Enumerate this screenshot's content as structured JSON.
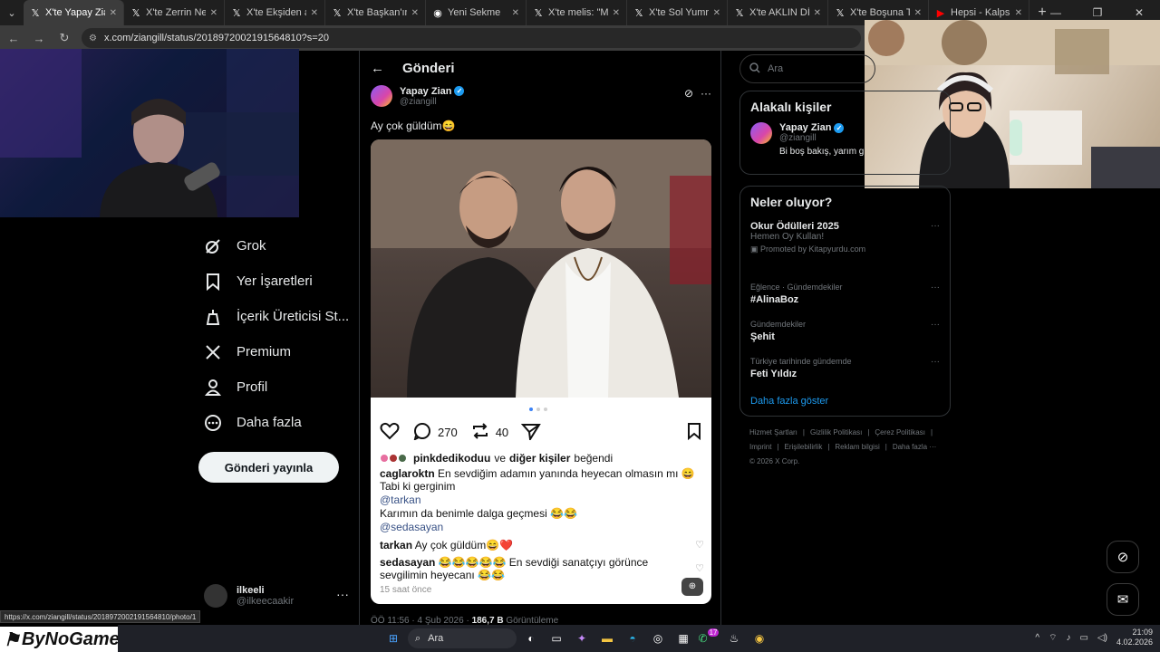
{
  "browser": {
    "tabs": [
      {
        "icon": "x-icon",
        "title": "X'te Yapay Zian: \"A",
        "active": true
      },
      {
        "icon": "x-icon",
        "title": "X'te Zerrin Nergiz",
        "active": false
      },
      {
        "icon": "x-icon",
        "title": "X'te Ekşiden alıntı",
        "active": false
      },
      {
        "icon": "x-icon",
        "title": "X'te Başkan'ın Ru",
        "active": false
      },
      {
        "icon": "chrome-icon",
        "title": "Yeni Sekme",
        "active": false
      },
      {
        "icon": "x-icon",
        "title": "X'te melis: \"Mate",
        "active": false
      },
      {
        "icon": "x-icon",
        "title": "X'te Sol Yumruk: \"",
        "active": false
      },
      {
        "icon": "x-icon",
        "title": "X'te AKLIN DİNİ: o",
        "active": false
      },
      {
        "icon": "x-icon",
        "title": "X'te Boşuna Tıklad",
        "active": false
      },
      {
        "icon": "youtube-icon",
        "title": "Hepsi - Kalpsizsin",
        "active": false
      }
    ],
    "url": "x.com/ziangill/status/2018972002191564810?s=20",
    "status_url": "https://x.com/ziangill/status/2018972002191564810/photo/1"
  },
  "sidebar": {
    "items": [
      {
        "label": "Grok",
        "icon": "grok-icon"
      },
      {
        "label": "Yer İşaretleri",
        "icon": "bookmark-icon"
      },
      {
        "label": "İçerik Üreticisi St...",
        "icon": "creator-studio-icon"
      },
      {
        "label": "Premium",
        "icon": "x-logo-icon"
      },
      {
        "label": "Profil",
        "icon": "person-icon"
      },
      {
        "label": "Daha fazla",
        "icon": "more-circle-icon"
      }
    ],
    "post_button": "Gönderi yayınla",
    "account": {
      "name": "ilkeeli",
      "handle": "@ilkeecaakir"
    }
  },
  "post": {
    "header": "Gönderi",
    "author_name": "Yapay Zian",
    "author_handle": "@ziangill",
    "text": "Ay çok güldüm😄",
    "meta_time": "ÖÖ 11:56 · 4 Şub 2026 · ",
    "meta_views": "186,7 B",
    "meta_views_label": " Görüntüleme"
  },
  "instagram": {
    "comment_count": "270",
    "repost_count": "40",
    "liked_user": "pinkdedikoduu",
    "liked_joiner": " ve ",
    "liked_others": "diğer kişiler",
    "liked_suffix": " beğendi",
    "comments": [
      {
        "user": "caglaroktn",
        "text": " En sevdiğim adamın yanında heyecan olmasın mı 😄"
      },
      {
        "user": "",
        "text": "Tabi ki gerginim"
      },
      {
        "user": "",
        "text": "@tarkan"
      },
      {
        "user": "",
        "text": "Karımın da benimle  dalga geçmesi 😂😂"
      },
      {
        "user": "",
        "text": "@sedasayan"
      },
      {
        "user": "tarkan",
        "text": " Ay çok güldüm😄❤️"
      },
      {
        "user": "sedasayan",
        "text": " 😂😂😂😂😂 En sevdiği sanatçıyı görünce"
      },
      {
        "user": "",
        "text": "sevgilimin heyecanı 😂😂"
      }
    ],
    "time": "15 saat önce"
  },
  "right": {
    "search_placeholder": "Ara",
    "related_title": "Alakalı kişiler",
    "related_name": "Yapay Zian",
    "related_handle": "@ziangill",
    "related_bio": "Bi boş bakış, yarım g",
    "trends_title": "Neler oluyor?",
    "trends": [
      {
        "category": "",
        "title": "Okur Ödülleri 2025",
        "subtitle": "Hemen Oy Kullan!",
        "promoted": "Promoted by Kitapyurdu.com"
      },
      {
        "category": "Eğlence · Gündemdekiler",
        "title": "#AlinaBoz"
      },
      {
        "category": "Gündemdekiler",
        "title": "Şehit"
      },
      {
        "category": "Türkiye tarihinde gündemde",
        "title": "Feti Yıldız"
      }
    ],
    "show_more": "Daha fazla göster",
    "footer_links": [
      "Hizmet Şartları",
      "|",
      "Gizlilik Politikası",
      "|",
      "Çerez Politikası",
      "|",
      "Imprint",
      "|",
      "Erişilebilirlik",
      "|",
      "Reklam bilgisi",
      "|",
      "Daha fazla ···"
    ],
    "copyright": "© 2026 X Corp."
  },
  "overlay": {
    "logo": "ByNoGame"
  },
  "taskbar": {
    "search": "Ara",
    "time": "21:09",
    "date": "4.02.2026",
    "badge": "17"
  }
}
